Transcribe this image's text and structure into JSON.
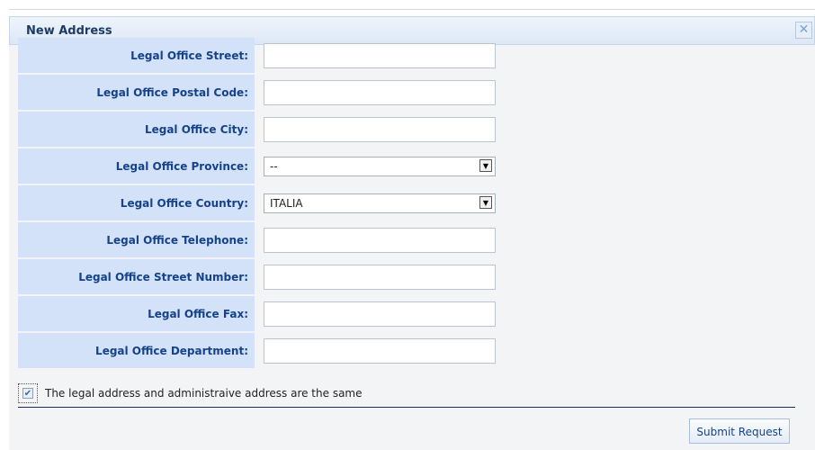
{
  "dialog": {
    "title": "New Address",
    "close_icon": "close-icon",
    "fields": [
      {
        "label": "Legal Office Street:",
        "type": "text",
        "value": ""
      },
      {
        "label": "Legal Office Postal Code:",
        "type": "text",
        "value": ""
      },
      {
        "label": "Legal Office City:",
        "type": "text",
        "value": ""
      },
      {
        "label": "Legal Office Province:",
        "type": "select",
        "value": "--"
      },
      {
        "label": "Legal Office Country:",
        "type": "select",
        "value": "ITALIA"
      },
      {
        "label": "Legal Office Telephone:",
        "type": "text",
        "value": ""
      },
      {
        "label": "Legal Office Street Number:",
        "type": "text",
        "value": ""
      },
      {
        "label": "Legal Office Fax:",
        "type": "text",
        "value": ""
      },
      {
        "label": "Legal Office Department:",
        "type": "text",
        "value": ""
      }
    ],
    "same_address": {
      "label": "The legal address and administraive address are the same",
      "checked": true
    },
    "submit_label": "Submit Request"
  },
  "colors": {
    "label_bg": "#d3e2f8",
    "label_text": "#15428b",
    "dialog_bg": "#f3f4f5",
    "divider": "#1b2d5a"
  }
}
